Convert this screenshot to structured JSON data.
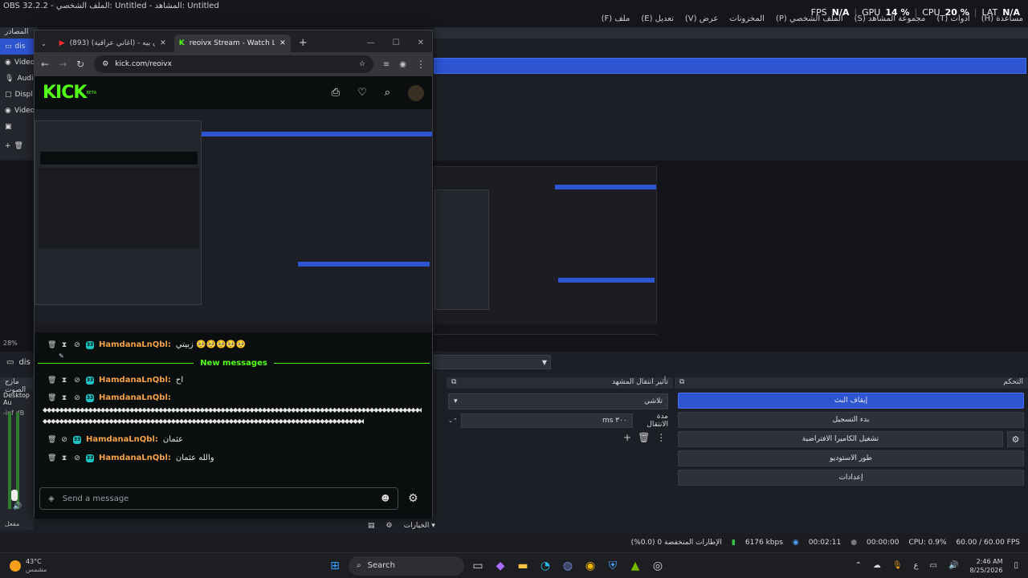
{
  "window": {
    "title": "OBS 32.2.2 - الملف الشخصي: Untitled - المشاهد: Untitled"
  },
  "menu": [
    "ملف (F)",
    "تعديل (E)",
    "عرض (V)",
    "المخزونات",
    "الملف الشخصي (P)",
    "مجموعة المشاهد (S)",
    "أدوات (T)",
    "مساعدة (H)"
  ],
  "stats": {
    "fps_label": "FPS",
    "fps": "N/A",
    "gpu_label": "GPU",
    "gpu": "14 %",
    "cpu_label": "CPU",
    "cpu": "20 %",
    "lat_label": "LAT",
    "lat": "N/A"
  },
  "sources": {
    "title": "المصادر",
    "items": [
      {
        "label": "dis",
        "icon": "monitor-icon",
        "selected": true
      },
      {
        "label": "Video",
        "icon": "camera-icon"
      },
      {
        "label": "Audio",
        "icon": "mic-icon"
      },
      {
        "label": "Displ",
        "icon": "display-icon"
      },
      {
        "label": "Video",
        "icon": "camera-icon"
      },
      {
        "label": "",
        "icon": "window-icon"
      }
    ]
  },
  "zoom_label": "28%",
  "scene_row": {
    "label": "dis"
  },
  "audio_dock": {
    "title": "مازج الصوت",
    "device": "Desktop Au",
    "level": "-inf dB",
    "muted_label": "مفعل"
  },
  "transition": {
    "title": "تأثير انتقال المشهد",
    "selected": "تلاشي",
    "duration_label": "مدة الانتقال",
    "duration": "٣٠٠ ms"
  },
  "controls": {
    "title": "التحكم",
    "buttons": [
      "إيقاف البث",
      "بدء التسجيل",
      "تشغيل الكاميرا الافتراضية",
      "طور الاستوديو",
      "إعدادات"
    ]
  },
  "options_label": "الخيارات",
  "status": {
    "dropped": "الإطارات المنخفضة 0 (0.0%)",
    "kbps": "6176 kbps",
    "live_time": "00:02:11",
    "rec_time": "00:00:00",
    "cpu": "CPU: 0.9%",
    "fps": "60.00 / 60.00 FPS"
  },
  "browser": {
    "tabs": [
      {
        "label": "(893) زلين- تخون بيه - (أغاني عراقية)",
        "icon": "youtube-icon"
      },
      {
        "label": "reoivx Stream - Watch Live on Kick",
        "icon": "kick-icon",
        "active": true
      }
    ],
    "url": "kick.com/reoivx",
    "kick_logo": "KICK",
    "kick_beta": "BETA",
    "chat": {
      "new_messages": "New messages",
      "messages": [
        {
          "user": "HamdanaLnQbl:",
          "text": "زبيتي 🥺🥺🥺🥺🥺",
          "badge": "33"
        },
        {
          "user": "HamdanaLnQbl:",
          "text": "اح",
          "badge": "33"
        },
        {
          "user": "HamdanaLnQbl:",
          "text": "",
          "badge": "33"
        },
        {
          "user": "HamdanaLnQbl:",
          "text": "عثمان",
          "badge": "33"
        },
        {
          "user": "HamdanaLnQbl:",
          "text": "والله عثمان",
          "badge": "33"
        }
      ],
      "placeholder": "Send a message"
    }
  },
  "taskbar": {
    "weather_temp": "43°C",
    "weather_text": "مشمس",
    "search": "Search",
    "time": "2:46 AM",
    "date": "8/25/2026",
    "lang": "ع"
  }
}
